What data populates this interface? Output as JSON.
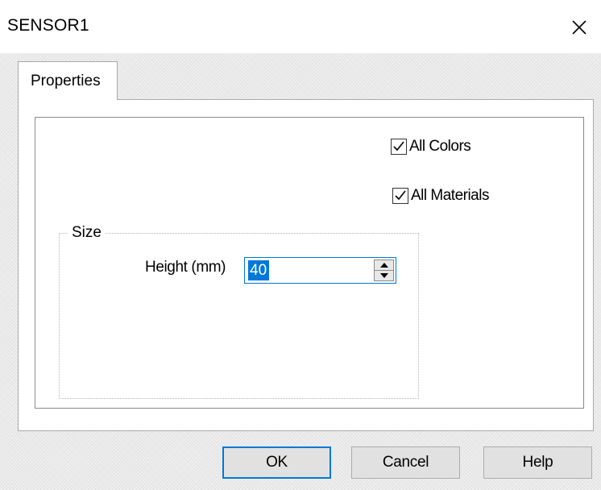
{
  "window": {
    "title": "SENSOR1",
    "close_icon": "close-icon"
  },
  "tabs": [
    {
      "label": "Properties",
      "active": true
    }
  ],
  "options": {
    "all_colors": {
      "label": "All Colors",
      "checked": true
    },
    "all_materials": {
      "label": "All Materials",
      "checked": true
    }
  },
  "size_group": {
    "legend": "Size",
    "height_label": "Height (mm)",
    "height_value": "40"
  },
  "buttons": {
    "ok": "OK",
    "cancel": "Cancel",
    "help": "Help"
  },
  "colors": {
    "accent": "#0078d7",
    "button_bg": "#e1e1e1"
  }
}
